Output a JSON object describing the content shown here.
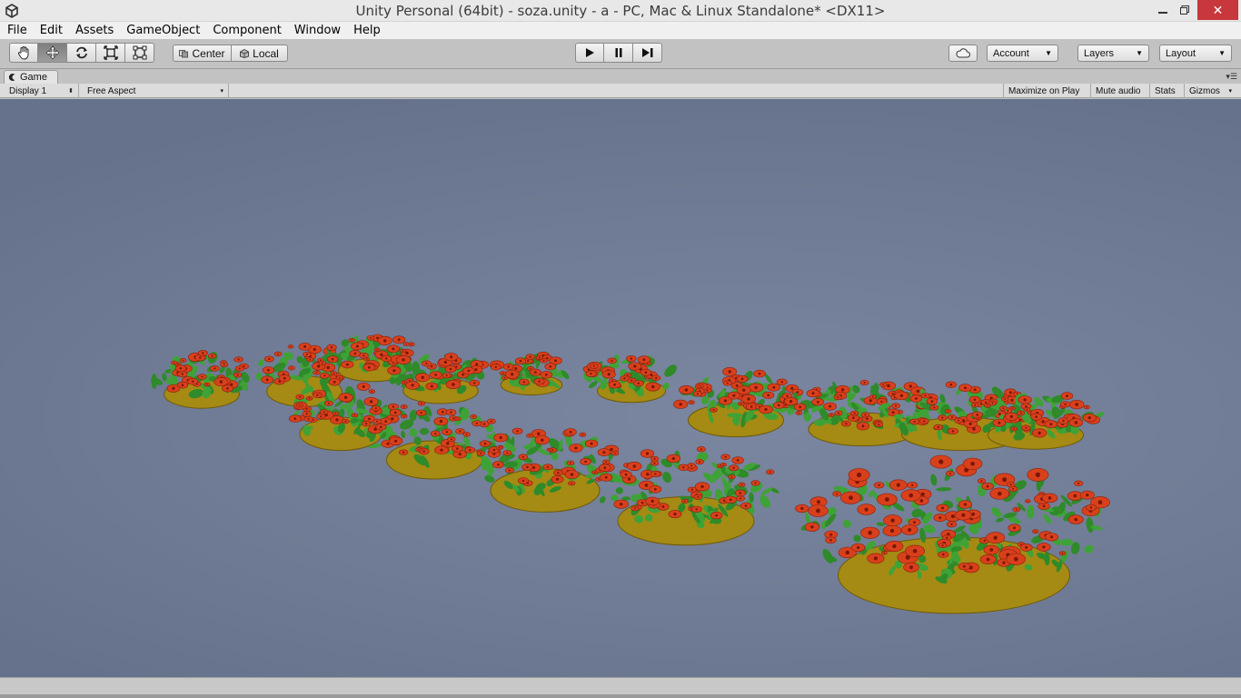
{
  "window": {
    "title": "Unity Personal (64bit) - soza.unity - a - PC, Mac & Linux Standalone* <DX11>",
    "close_glyph": "✕"
  },
  "menu": [
    "File",
    "Edit",
    "Assets",
    "GameObject",
    "Component",
    "Window",
    "Help"
  ],
  "toolbar": {
    "transform_tools": [
      "hand-icon",
      "move-icon",
      "rotate-icon",
      "scale-icon",
      "rect-icon"
    ],
    "active_tool": "move-icon",
    "pivot": "Center",
    "space": "Local",
    "account": "Account",
    "layers": "Layers",
    "layout": "Layout"
  },
  "game_tab": {
    "label": "Game",
    "display": "Display 1",
    "aspect": "Free Aspect",
    "options": [
      "Maximize on Play",
      "Mute audio",
      "Stats",
      "Gizmos"
    ]
  },
  "colors": {
    "sky": "#6f7b94",
    "leaf": "#2f8a2a",
    "flower": "#d8401c",
    "pot": "#a58a14"
  }
}
